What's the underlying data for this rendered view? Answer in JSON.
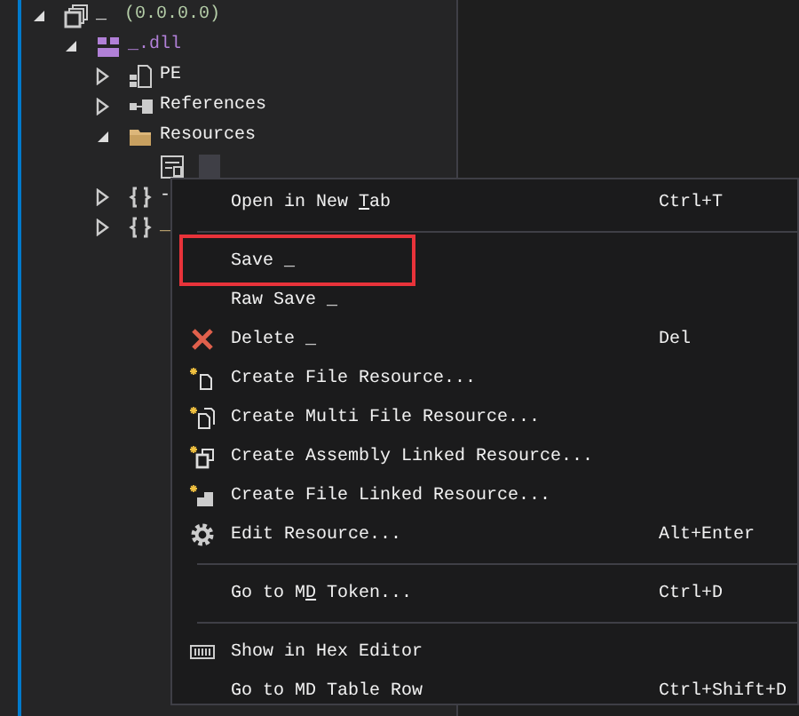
{
  "tree": [
    {
      "kind": "assembly",
      "name": "_",
      "version": "(0.0.0.0)",
      "expanded": true,
      "selected": false,
      "children": [
        {
          "kind": "module",
          "name": "_.dll",
          "expanded": true,
          "selected": false,
          "children": [
            {
              "kind": "pe",
              "name": "PE",
              "expanded": false,
              "selected": false
            },
            {
              "kind": "references",
              "name": "References",
              "expanded": false,
              "selected": false
            },
            {
              "kind": "folder",
              "name": "Resources",
              "expanded": true,
              "selected": false,
              "children": [
                {
                  "kind": "resource",
                  "selected": true
                }
              ]
            },
            {
              "kind": "namespace",
              "name": "-",
              "expanded": false,
              "selected": false
            },
            {
              "kind": "namespace",
              "name": "_",
              "expanded": false,
              "selected": false
            }
          ]
        }
      ]
    }
  ],
  "context_menu": [
    {
      "kind": "plain",
      "label_parts": [
        {
          "text": "Open in New "
        },
        {
          "text": "T",
          "underlined": true
        },
        {
          "text": "ab"
        }
      ],
      "shortcut": "Ctrl+T"
    },
    {
      "kind": "separator"
    },
    {
      "kind": "plain",
      "label_parts": [
        {
          "text": "Save _"
        }
      ],
      "highlighted": true
    },
    {
      "kind": "plain",
      "label_parts": [
        {
          "text": "Raw Save _"
        }
      ]
    },
    {
      "kind": "delete",
      "label_parts": [
        {
          "text": "Delete _"
        }
      ],
      "shortcut": "Del"
    },
    {
      "kind": "create-file",
      "label_parts": [
        {
          "text": "Create File Resource..."
        }
      ]
    },
    {
      "kind": "create-multi",
      "label_parts": [
        {
          "text": "Create Multi File Resource..."
        }
      ]
    },
    {
      "kind": "create-assembly",
      "label_parts": [
        {
          "text": "Create Assembly Linked Resource..."
        }
      ]
    },
    {
      "kind": "create-linked",
      "label_parts": [
        {
          "text": "Create File Linked Resource..."
        }
      ]
    },
    {
      "kind": "settings",
      "label_parts": [
        {
          "text": "Edit Resource..."
        }
      ],
      "shortcut": "Alt+Enter"
    },
    {
      "kind": "separator"
    },
    {
      "kind": "plain",
      "label_parts": [
        {
          "text": "Go to M"
        },
        {
          "text": "D",
          "underlined": true
        },
        {
          "text": " Token..."
        }
      ],
      "shortcut": "Ctrl+D"
    },
    {
      "kind": "separator"
    },
    {
      "kind": "hex",
      "label_parts": [
        {
          "text": "Show in Hex Editor"
        }
      ]
    },
    {
      "kind": "plain",
      "label_parts": [
        {
          "text": "Go to MD Table Row"
        }
      ],
      "shortcut": "Ctrl+Shift+D"
    }
  ]
}
